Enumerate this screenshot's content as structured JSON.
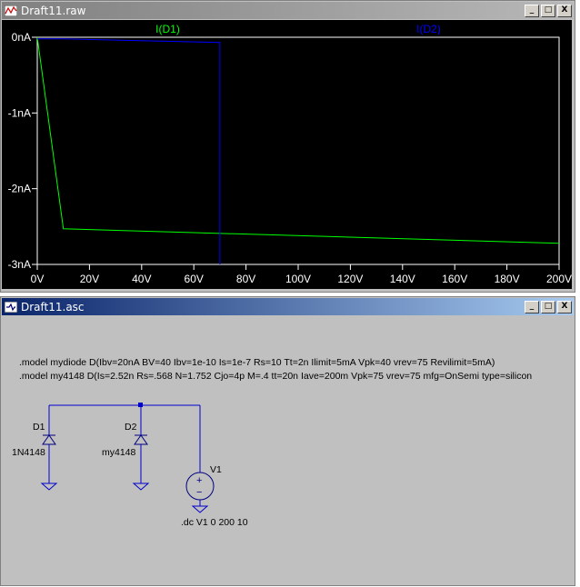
{
  "plot_window": {
    "title": "Draft11.raw",
    "buttons": {
      "minimize": "_",
      "maximize": "□",
      "close": "X"
    },
    "background_color": "#000000",
    "grid_color": "#ffffff"
  },
  "schematic_window": {
    "title": "Draft11.asc",
    "buttons": {
      "minimize": "_",
      "maximize": "□",
      "close": "X"
    },
    "background_color": "#c0c0c0",
    "wire_color": "#0000cc",
    "directives": [
      ".model mydiode D(Ibv=20nA BV=40 Ibv=1e-10 Is=1e-7 Rs=10 Tt=2n Ilimit=5mA Vpk=40 vrev=75 Revilimit=5mA)",
      ".model my4148 D(Is=2.52n Rs=.568 N=1.752 Cjo=4p M=.4 tt=20n Iave=200m Vpk=75 vrev=75 mfg=OnSemi type=silicon"
    ],
    "components": {
      "d1": {
        "ref": "D1",
        "value": "1N4148"
      },
      "d2": {
        "ref": "D2",
        "value": "my4148"
      },
      "v1": {
        "ref": "V1",
        "plus": "+",
        "minus": "−"
      }
    },
    "dc_command": ".dc V1 0 200 10"
  },
  "chart_data": {
    "type": "line",
    "x_unit": "V",
    "y_unit": "nA",
    "xlim": [
      0,
      200
    ],
    "ylim": [
      -3,
      0
    ],
    "x_ticks": [
      0,
      20,
      40,
      60,
      80,
      100,
      120,
      140,
      160,
      180,
      200
    ],
    "x_tick_labels": [
      "0V",
      "20V",
      "40V",
      "60V",
      "80V",
      "100V",
      "120V",
      "140V",
      "160V",
      "180V",
      "200V"
    ],
    "y_ticks": [
      0,
      -1,
      -2,
      -3
    ],
    "y_tick_labels": [
      "0nA",
      "-1nA",
      "-2nA",
      "-3nA"
    ],
    "grid": false,
    "series": [
      {
        "name": "I(D1)",
        "color": "#00ff00",
        "x": [
          0,
          10,
          200
        ],
        "y": [
          0,
          -2.53,
          -2.72
        ]
      },
      {
        "name": "I(D2)",
        "color": "#0000ff",
        "x": [
          0,
          10,
          70,
          70
        ],
        "y": [
          -0.02,
          -0.02,
          -0.07,
          -3
        ]
      }
    ]
  }
}
